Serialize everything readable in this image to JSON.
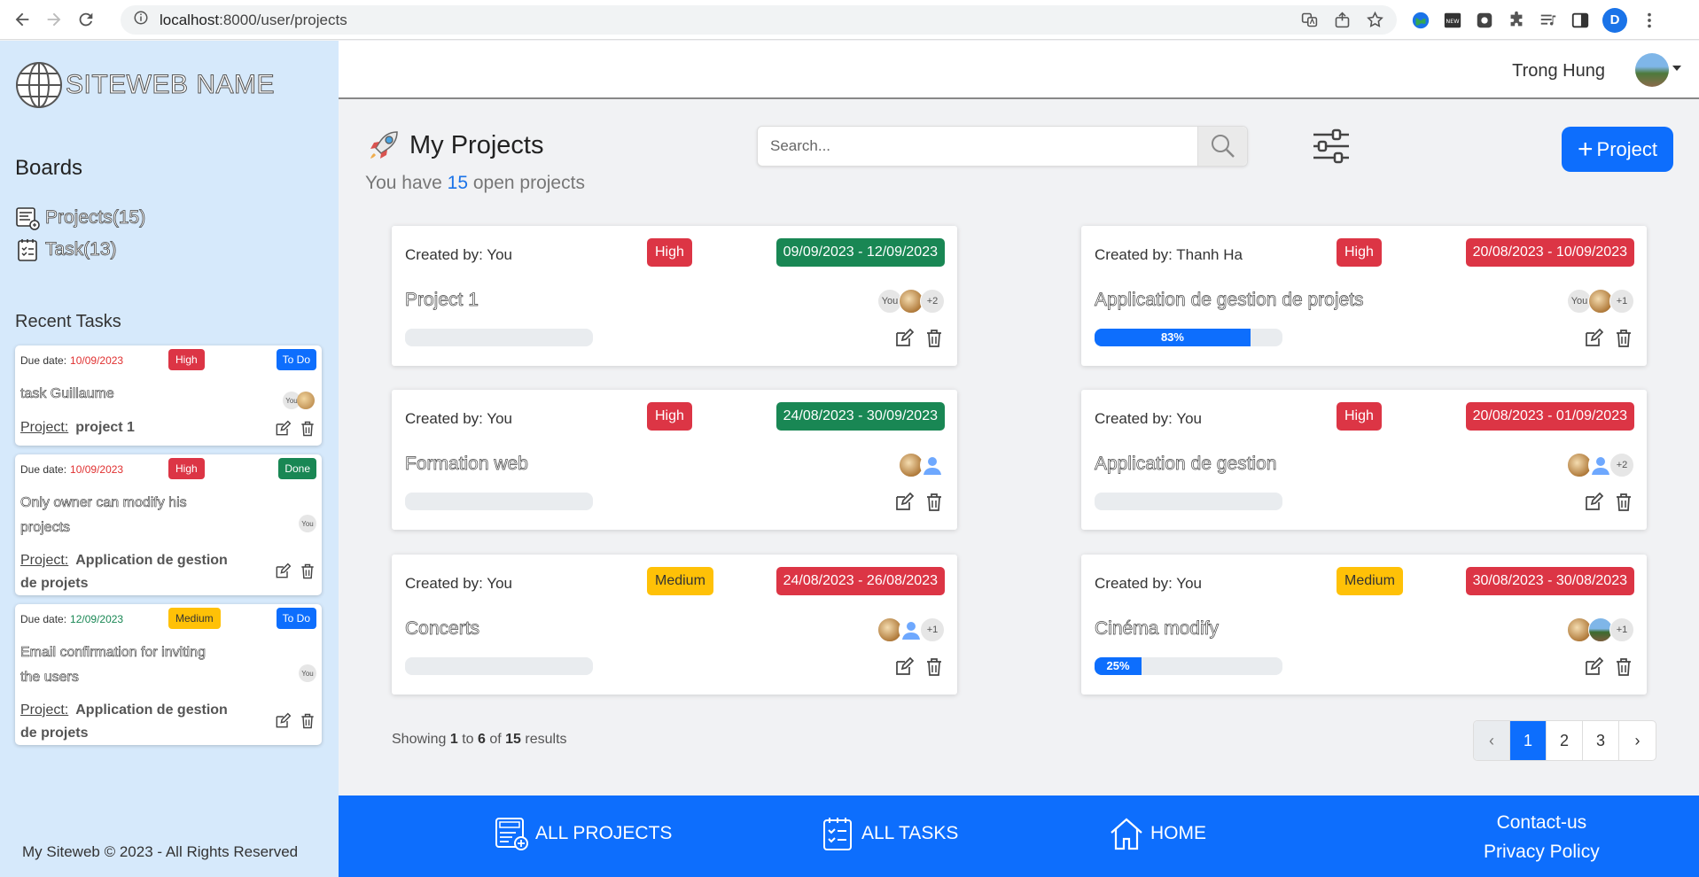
{
  "browser": {
    "url_host": "localhost",
    "url_path": ":8000/user/projects",
    "profile_initial": "D"
  },
  "sidebar": {
    "logo_text": "SITEWEB NAME",
    "boards_title": "Boards",
    "links": [
      {
        "label": "Projects(15)",
        "icon": "projects-icon"
      },
      {
        "label": "Task(13)",
        "icon": "tasks-icon"
      }
    ],
    "recent_title": "Recent Tasks",
    "copyright": "My Siteweb © 2023 - All Rights Reserved"
  },
  "recent_tasks": [
    {
      "due_label": "Due date:",
      "due_date": "10/09/2023",
      "priority": "High",
      "status": "To Do",
      "name": "task Guillaume",
      "project_label": "Project:",
      "project": "project 1",
      "members": [
        "You"
      ]
    },
    {
      "due_label": "Due date:",
      "due_date": "10/09/2023",
      "priority": "High",
      "status": "Done",
      "name": "Only owner can modify his projects",
      "project_label": "Project:",
      "project": "Application de gestion de projets",
      "members": [
        "You"
      ]
    },
    {
      "due_label": "Due date:",
      "due_date": "12/09/2023",
      "priority": "Medium",
      "status": "To Do",
      "name": "Email confirmation for inviting the users",
      "project_label": "Project:",
      "project": "Application de gestion de projets",
      "members": [
        "You"
      ]
    }
  ],
  "header": {
    "user_name": "Trong Hung"
  },
  "main": {
    "title": "My Projects",
    "subtitle_prefix": "You have",
    "open_count": "15",
    "subtitle_suffix": "open projects",
    "search_placeholder": "Search...",
    "add_button": "Project"
  },
  "projects": [
    {
      "creator": "Created by: You",
      "priority": "High",
      "dates": "09/09/2023 - 12/09/2023",
      "name": "Project 1",
      "progress": 0,
      "progress_label": "",
      "members": [
        "You",
        "avatar",
        "+2"
      ]
    },
    {
      "creator": "Created by: Thanh Ha",
      "priority": "High",
      "dates": "20/08/2023 - 10/09/2023",
      "name": "Application de gestion de projets",
      "progress": 83,
      "progress_label": "83%",
      "members": [
        "You",
        "avatar",
        "+1"
      ]
    },
    {
      "creator": "Created by: You",
      "priority": "High",
      "dates": "24/08/2023 - 30/09/2023",
      "name": "Formation web",
      "progress": 0,
      "progress_label": "",
      "members": [
        "avatar",
        "user"
      ]
    },
    {
      "creator": "Created by: You",
      "priority": "High",
      "dates": "20/08/2023 - 01/09/2023",
      "name": "Application de gestion",
      "progress": 0,
      "progress_label": "",
      "members": [
        "avatar",
        "user",
        "+2"
      ]
    },
    {
      "creator": "Created by: You",
      "priority": "Medium",
      "dates": "24/08/2023 - 26/08/2023",
      "name": "Concerts",
      "progress": 0,
      "progress_label": "",
      "members": [
        "avatar",
        "user",
        "+1"
      ]
    },
    {
      "creator": "Created by: You",
      "priority": "Medium",
      "dates": "30/08/2023 - 30/08/2023",
      "name": "Cinéma modify",
      "progress": 25,
      "progress_label": "25%",
      "members": [
        "avatar",
        "avatar2",
        "+1"
      ]
    }
  ],
  "pagination": {
    "showing": "Showing",
    "from": "1",
    "to_word": "to",
    "to": "6",
    "of_word": "of",
    "total": "15",
    "results_word": "results",
    "prev": "‹",
    "pages": [
      "1",
      "2",
      "3"
    ],
    "next": "›",
    "active_page": "1"
  },
  "footer": {
    "all_projects": "ALL PROJECTS",
    "all_tasks": "ALL TASKS",
    "home": "HOME",
    "contact": "Contact-us",
    "privacy": "Privacy Policy"
  },
  "colors": {
    "primary": "#0d6efd",
    "high": "#dc3545",
    "medium": "#ffc107",
    "green": "#198754",
    "sidebar": "#d6e9fb"
  }
}
